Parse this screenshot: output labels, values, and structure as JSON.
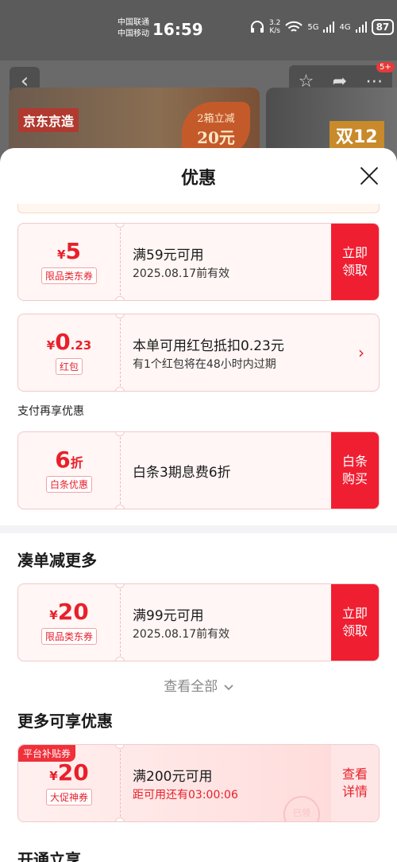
{
  "status_bar": {
    "carrier1": "中国联通",
    "carrier2": "中国移动",
    "time": "16:59",
    "net_speed_value": "3.2",
    "net_speed_unit": "K/s",
    "signal1": "5G",
    "signal2": "4G",
    "battery": "87"
  },
  "background_page": {
    "badge": "5+",
    "banner1_tag": "京东京造",
    "banner1_promo_line1": "2箱立减",
    "banner1_promo_line2": "20元",
    "banner2_logo": "双12"
  },
  "sheet": {
    "title": "优惠"
  },
  "coupons_top": [
    {
      "currency": "¥",
      "amount": "5",
      "tag": "限品类东券",
      "line1": "满59元可用",
      "line2": "2025.08.17前有效",
      "button": "立即领取"
    }
  ],
  "red_packet": {
    "currency": "¥",
    "amount_int": "0",
    "amount_dec": ".23",
    "tag": "红包",
    "line1": "本单可用红包抵扣0.23元",
    "line2": "有1个红包将在48小时内过期"
  },
  "pay_section": {
    "label": "支付再享优惠",
    "amount": "6",
    "unit": "折",
    "tag": "白条优惠",
    "line1": "白条3期息费6折",
    "button": "白条购买"
  },
  "combine_section": {
    "title": "凑单减更多",
    "currency": "¥",
    "amount": "20",
    "tag": "限品类东券",
    "line1": "满99元可用",
    "line2": "2025.08.17前有效",
    "button": "立即领取",
    "view_all": "查看全部"
  },
  "more_section": {
    "title": "更多可享优惠",
    "platform_tag": "平台补贴券",
    "currency": "¥",
    "amount": "20",
    "tag": "大促神券",
    "line1": "满200元可用",
    "line2": "距可用还有03:00:06",
    "button": "查看详情",
    "watermark": "已领"
  },
  "next_section": {
    "title": "开通立享"
  }
}
